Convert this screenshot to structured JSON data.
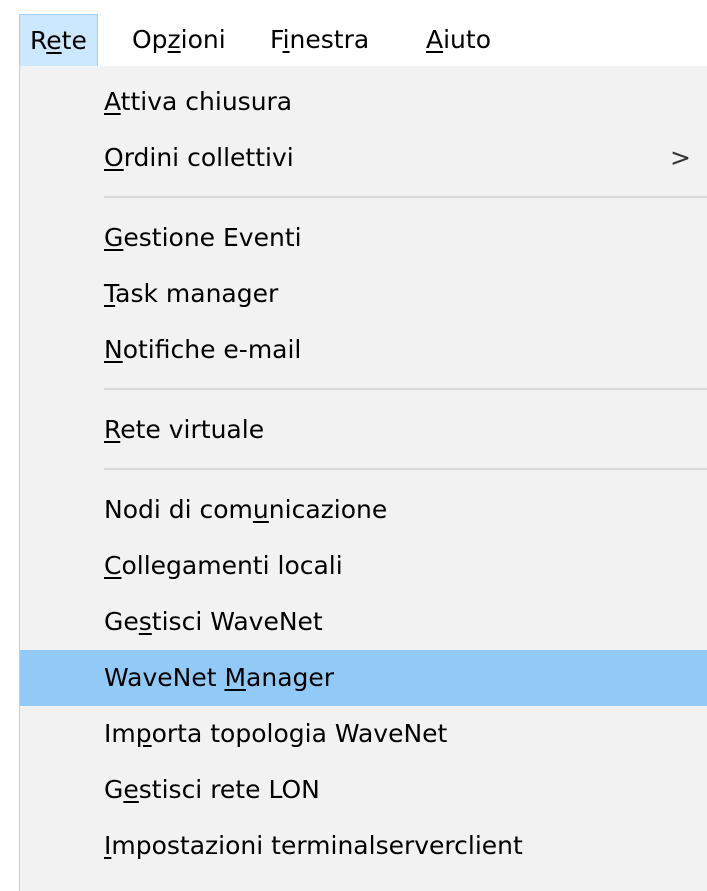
{
  "menubar": {
    "items": [
      {
        "pre": "R",
        "key": "e",
        "post": "te",
        "open": true
      },
      {
        "pre": "Op",
        "key": "z",
        "post": "ioni",
        "open": false
      },
      {
        "pre": "F",
        "key": "i",
        "post": "nestra",
        "open": false
      },
      {
        "pre": "",
        "key": "A",
        "post": "iuto",
        "open": false
      }
    ]
  },
  "dropdown": {
    "groups": [
      [
        {
          "pre": "",
          "key": "A",
          "post": "ttiva chiusura"
        },
        {
          "pre": "",
          "key": "O",
          "post": "rdini collettivi",
          "submenu": true,
          "arrow": ">"
        }
      ],
      [
        {
          "pre": "",
          "key": "G",
          "post": "estione Eventi"
        },
        {
          "pre": "",
          "key": "T",
          "post": "ask manager"
        },
        {
          "pre": "",
          "key": "N",
          "post": "otifiche e-mail"
        }
      ],
      [
        {
          "pre": "",
          "key": "R",
          "post": "ete virtuale"
        }
      ],
      [
        {
          "pre": "Nodi di com",
          "key": "u",
          "post": "nicazione"
        },
        {
          "pre": "",
          "key": "C",
          "post": "ollegamenti locali"
        },
        {
          "pre": "Ge",
          "key": "s",
          "post": "tisci WaveNet"
        },
        {
          "pre": "WaveNet ",
          "key": "M",
          "post": "anager",
          "highlighted": true
        },
        {
          "pre": "Im",
          "key": "p",
          "post": "orta topologia WaveNet"
        },
        {
          "pre": "G",
          "key": "e",
          "post": "stisci rete LON"
        },
        {
          "pre": "",
          "key": "I",
          "post": "mpostazioni terminalserverclient"
        }
      ]
    ]
  },
  "colors": {
    "menu_background": "#f2f2f2",
    "highlight": "#91c9f7",
    "open_menu_tab": "#cce8ff",
    "separator": "#d7d7d7"
  }
}
